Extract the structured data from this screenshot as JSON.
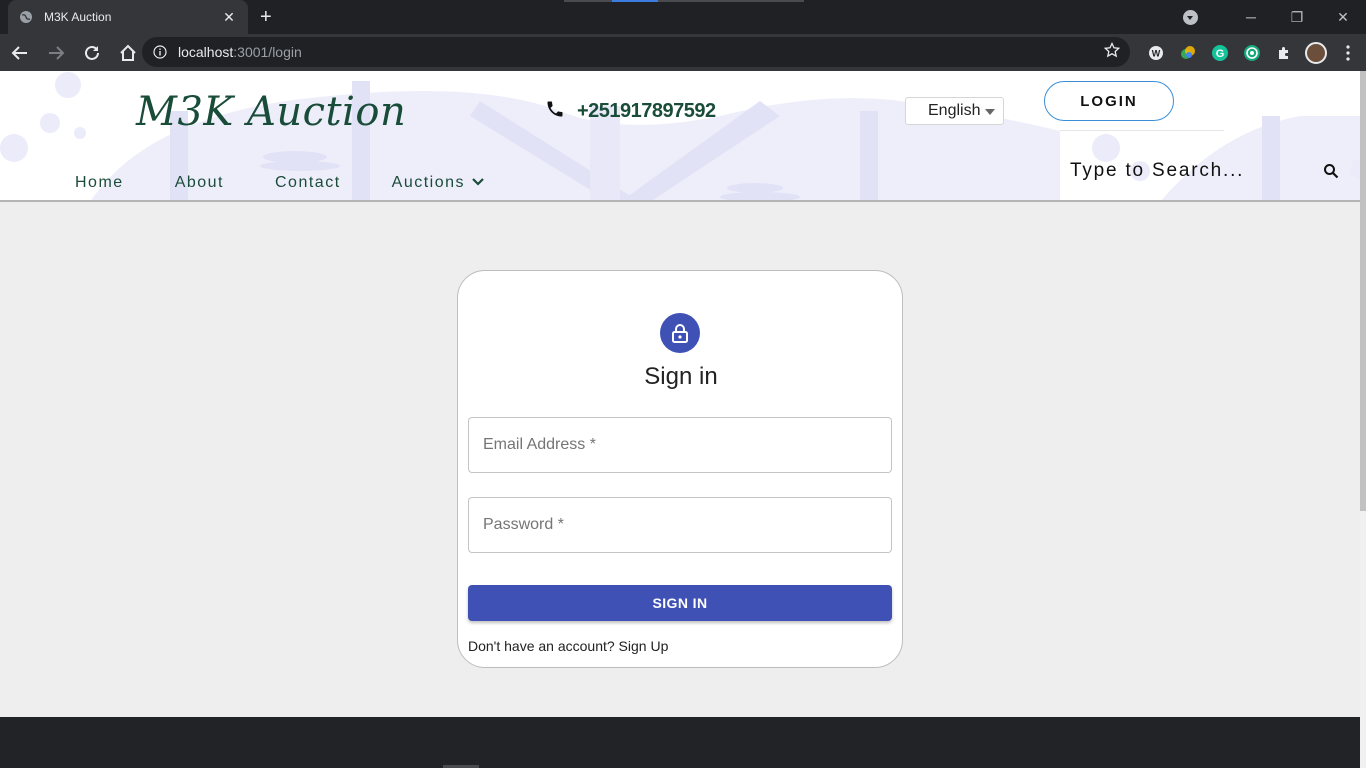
{
  "browser": {
    "tab_title": "M3K Auction",
    "url_host": "localhost",
    "url_path": ":3001/login"
  },
  "header": {
    "logo": "M3K Auction",
    "phone": "+251917897592",
    "language": "English",
    "login_label": "LOGIN",
    "search_placeholder": "Type to Search...",
    "nav": [
      {
        "label": "Home"
      },
      {
        "label": "About"
      },
      {
        "label": "Contact"
      },
      {
        "label": "Auctions"
      }
    ]
  },
  "signin": {
    "title": "Sign in",
    "email_placeholder": "Email Address *",
    "password_placeholder": "Password *",
    "button_label": "SIGN IN",
    "signup_prompt": "Don't have an account? Sign Up"
  },
  "colors": {
    "brand_green": "#1a4c3a",
    "primary_indigo": "#3f51b5",
    "login_border": "#3b8ed6"
  }
}
